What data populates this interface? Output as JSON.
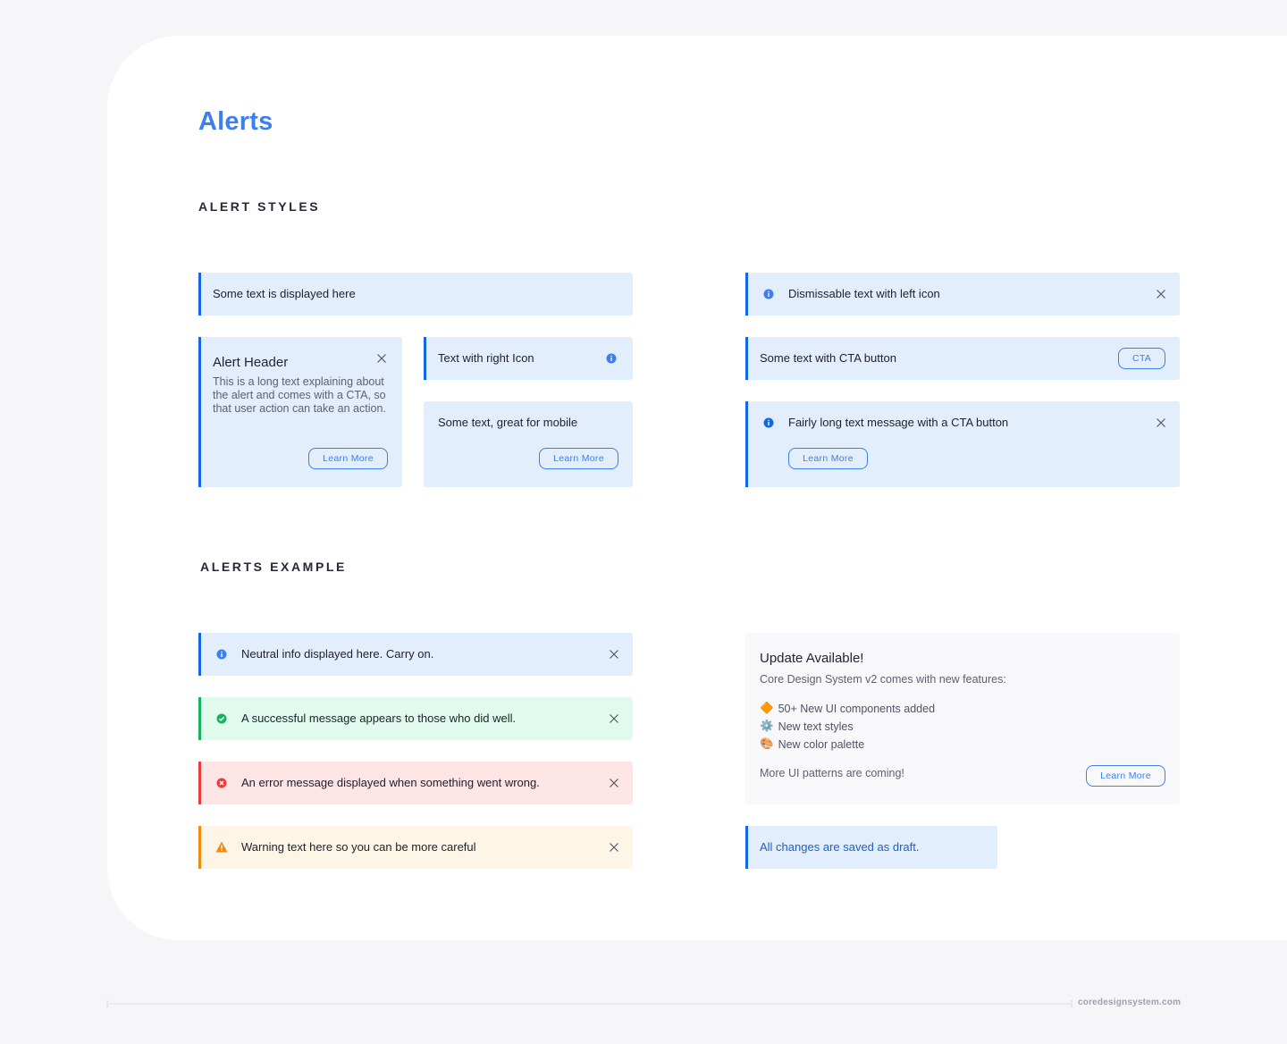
{
  "page": {
    "title": "Alerts",
    "footer_link": "coredesignsystem.com"
  },
  "colors": {
    "accent": "#3b7ff0",
    "info_bg": "#e3eefc",
    "info_border": "#1466e8",
    "success_bg": "#e0fbee",
    "success_border": "#16b45e",
    "error_bg": "#fde4e5",
    "error_border": "#ee3b3b",
    "warning_bg": "#fdf6e6",
    "warning_border": "#f28a0f"
  },
  "alert_styles": {
    "section_title": "ALERT STYLES",
    "simple": {
      "text": "Some text is displayed here"
    },
    "header_alert": {
      "title": "Alert Header",
      "body": "This is a long text explaining about the alert and comes with a CTA, so that user action can take an action.",
      "button": "Learn More",
      "close_icon": "close-icon"
    },
    "right_icon": {
      "text": "Text with right Icon",
      "icon": "info-icon"
    },
    "mobile": {
      "text": "Some text, great for mobile",
      "button": "Learn More"
    },
    "dismissable": {
      "text": "Dismissable text with left icon",
      "icon": "info-icon",
      "close_icon": "close-icon"
    },
    "cta": {
      "text": "Some text with CTA button",
      "button": "CTA"
    },
    "long_cta": {
      "text": "Fairly long text message with a CTA button",
      "icon": "info-icon",
      "button": "Learn More",
      "close_icon": "close-icon"
    }
  },
  "alerts_example": {
    "section_title": "ALERTS EXAMPLE",
    "info": {
      "text": "Neutral info displayed here. Carry on.",
      "icon": "info-icon"
    },
    "success": {
      "text": "A successful message appears to those who did well.",
      "icon": "check-circle-icon"
    },
    "error": {
      "text": "An error message displayed when something went wrong.",
      "icon": "error-circle-icon"
    },
    "warning": {
      "text": "Warning text here so you can be more careful",
      "icon": "warning-triangle-icon"
    },
    "update": {
      "title": "Update Available!",
      "description": "Core Design System v2 comes with new features:",
      "features": [
        {
          "emoji": "🔶",
          "text": "50+ New UI components added"
        },
        {
          "emoji": "⚙️",
          "text": "New text styles"
        },
        {
          "emoji": "🎨",
          "text": "New color palette"
        }
      ],
      "footer_text": "More UI patterns are coming!",
      "button": "Learn More"
    },
    "draft": {
      "text": "All changes are saved as draft."
    }
  }
}
